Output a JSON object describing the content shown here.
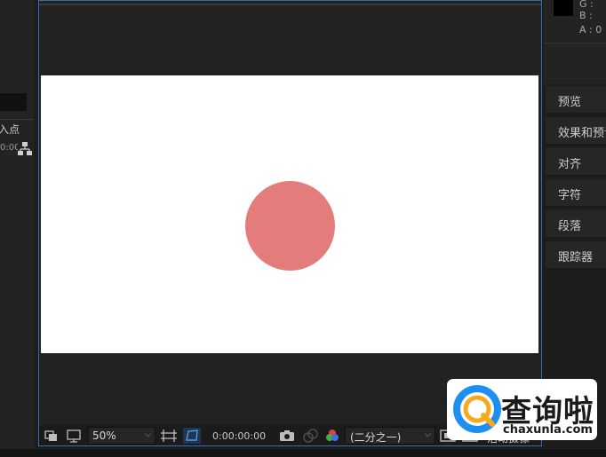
{
  "left_panel": {
    "column_header": "入点",
    "time_cell": "0:00:"
  },
  "info_panel": {
    "g_label": "G :",
    "b_label": "B :",
    "a_label": "A : 0"
  },
  "viewer": {
    "canvas_color": "#ffffff",
    "circle_color": "#e47c7c",
    "frame_color": "#2f6fb5",
    "toolbar": {
      "zoom": "50%",
      "timecode": "0:00:00:00",
      "resolution": "(二分之一)",
      "right_label": "活动摄像"
    }
  },
  "right_panels": {
    "tabs": [
      {
        "label": "预览"
      },
      {
        "label": "效果和预设"
      },
      {
        "label": "对齐"
      },
      {
        "label": "字符"
      },
      {
        "label": "段落"
      },
      {
        "label": "跟踪器"
      }
    ]
  },
  "watermark": {
    "text": "查询啦",
    "url": "chaxunla.com"
  }
}
